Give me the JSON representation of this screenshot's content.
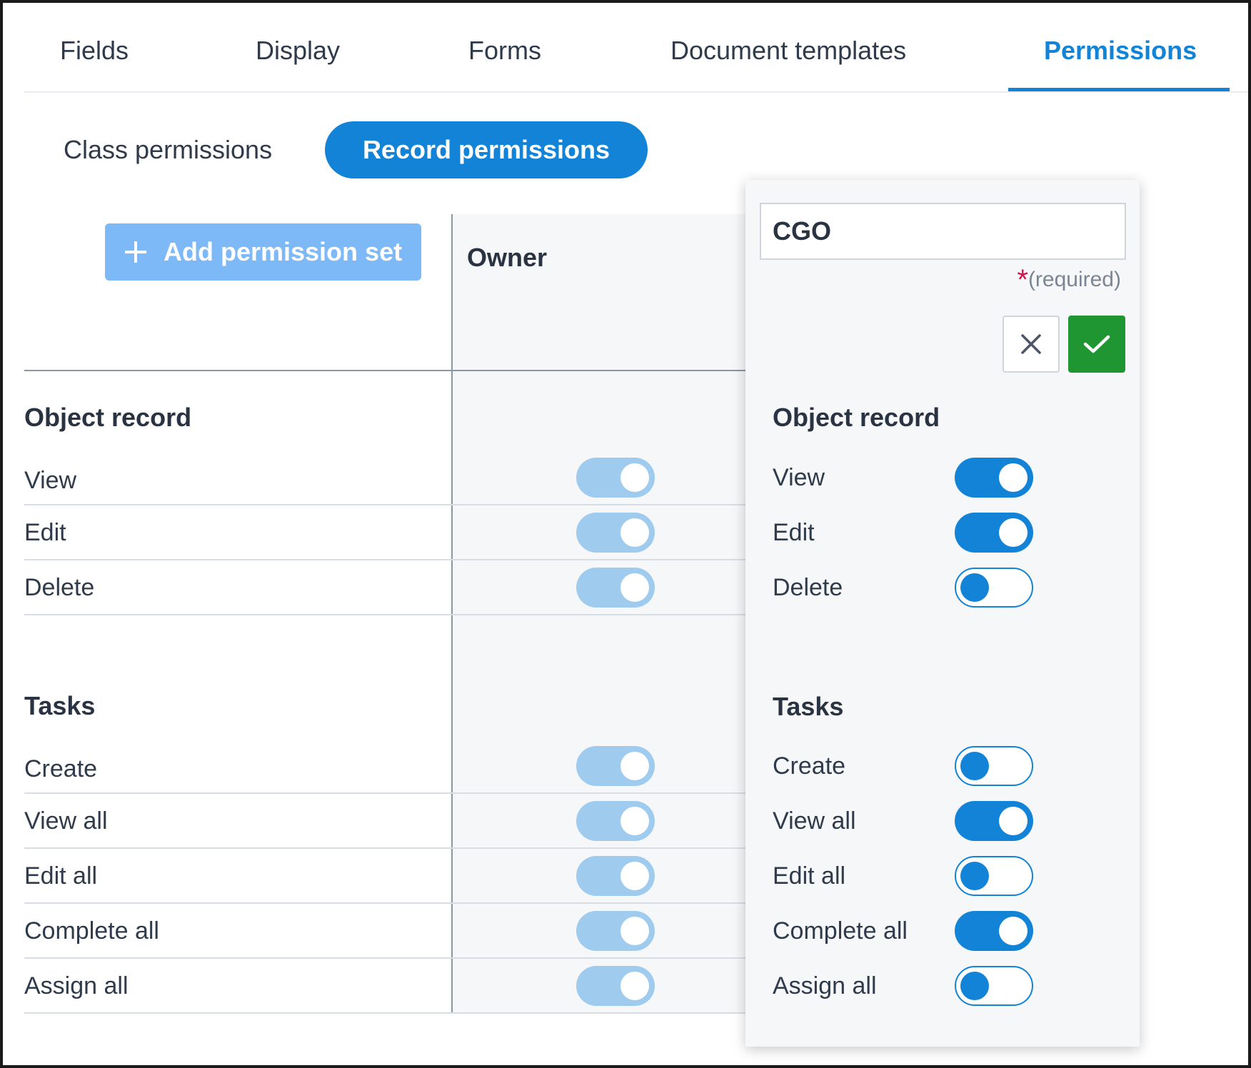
{
  "tabs": [
    {
      "label": "Fields",
      "active": false
    },
    {
      "label": "Display",
      "active": false
    },
    {
      "label": "Forms",
      "active": false
    },
    {
      "label": "Document templates",
      "active": false
    },
    {
      "label": "Permissions",
      "active": true
    }
  ],
  "subtabs": {
    "class_label": "Class permissions",
    "record_label": "Record permissions",
    "active": "record"
  },
  "add_button": {
    "label": "Add permission set"
  },
  "owner": {
    "header": "Owner"
  },
  "sections": {
    "object_record": {
      "title": "Object record",
      "rows": [
        "View",
        "Edit",
        "Delete"
      ]
    },
    "tasks": {
      "title": "Tasks",
      "rows": [
        "Create",
        "View all",
        "Edit all",
        "Complete all",
        "Assign all"
      ]
    }
  },
  "owner_toggles": {
    "object_record": [
      true,
      true,
      true
    ],
    "tasks": [
      true,
      true,
      true,
      true,
      true
    ]
  },
  "panel": {
    "name_value": "CGO",
    "required_star": "*",
    "required_text": "(required)",
    "object_record_title": "Object record",
    "tasks_title": "Tasks",
    "object_record_toggles": [
      true,
      true,
      false
    ],
    "tasks_toggles": [
      false,
      true,
      false,
      true,
      false
    ]
  },
  "colors": {
    "accent": "#1283d6",
    "accent_disabled": "#9ecbee",
    "add_button": "#7db8f7",
    "confirm": "#1f9631",
    "required_star": "#d0134b"
  }
}
